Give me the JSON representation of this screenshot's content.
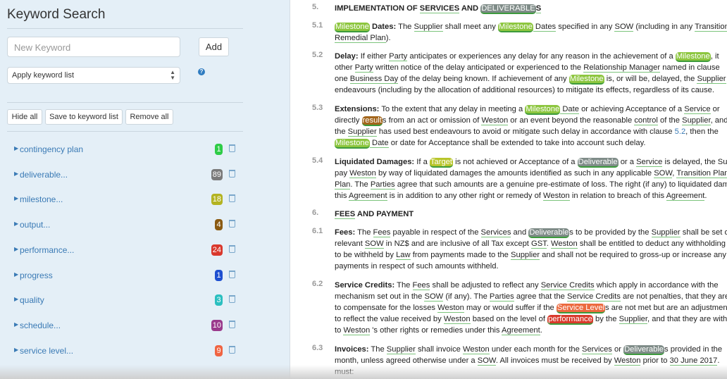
{
  "sidebar": {
    "title": "Keyword Search",
    "keyword_placeholder": "New Keyword",
    "add_label": "Add",
    "keyword_list_select": "Apply keyword list",
    "help_icon": "question-circle-icon",
    "hide_all": "Hide all",
    "save_to_list": "Save to keyword list",
    "remove_all": "Remove all",
    "keywords": [
      {
        "label": "contingency plan",
        "count": "1",
        "color": "#2ecc47"
      },
      {
        "label": "deliverable...",
        "count": "89",
        "color": "#7a7a7a"
      },
      {
        "label": "milestone...",
        "count": "18",
        "color": "#b3b322"
      },
      {
        "label": "output...",
        "count": "4",
        "color": "#8a5a12"
      },
      {
        "label": "performance...",
        "count": "24",
        "color": "#d9382c"
      },
      {
        "label": "progress",
        "count": "1",
        "color": "#1e4fd0"
      },
      {
        "label": "quality",
        "count": "3",
        "color": "#2bbfc0"
      },
      {
        "label": "schedule...",
        "count": "10",
        "color": "#9a3a8c"
      },
      {
        "label": "service level...",
        "count": "9",
        "color": "#f06442"
      }
    ]
  },
  "document": {
    "blocks": [
      {
        "num": "5.",
        "lines": [
          [
            [
              "IMPLEMENTATION OF ",
              "b"
            ],
            [
              "SERVICES",
              "bu"
            ],
            [
              " AND ",
              "b"
            ],
            [
              "DELIVERABLE",
              "hl-deliverable"
            ],
            [
              "S",
              "bu"
            ]
          ]
        ]
      },
      {
        "num": "5.1",
        "lines": [
          [
            [
              "Milestone",
              "hl-milestone"
            ],
            [
              " Dates:",
              "b"
            ],
            [
              " The ",
              ""
            ],
            [
              "Supplier",
              "u"
            ],
            [
              " shall meet any ",
              ""
            ],
            [
              "Milestone",
              "hl-milestone"
            ],
            [
              " Dates",
              "u"
            ],
            [
              " specified in any ",
              ""
            ],
            [
              "SOW",
              "u"
            ],
            [
              " (including in any ",
              ""
            ],
            [
              "Transition",
              "u"
            ]
          ],
          [
            [
              "Remedial Plan",
              "u"
            ],
            [
              ").",
              ""
            ]
          ]
        ]
      },
      {
        "num": "5.2",
        "lines": [
          [
            [
              "Delay:",
              "b"
            ],
            [
              " If either ",
              ""
            ],
            [
              "Party",
              "u"
            ],
            [
              " anticipates or experiences any delay for any reason in the achievement of a ",
              ""
            ],
            [
              "Milestone",
              "hl-milestone"
            ],
            [
              ", it",
              ""
            ]
          ],
          [
            [
              "other ",
              ""
            ],
            [
              "Party",
              "u"
            ],
            [
              " written notice of the delay anticipated or experienced to the ",
              ""
            ],
            [
              "Relationship Manager",
              "u"
            ],
            [
              " named in clause",
              ""
            ]
          ],
          [
            [
              "one ",
              ""
            ],
            [
              "Business Day",
              "u"
            ],
            [
              " of the delay being known. If achievement of any ",
              ""
            ],
            [
              "Milestone",
              "hl-milestone"
            ],
            [
              " is, or will be, delayed, the ",
              ""
            ],
            [
              "Supplier",
              "u"
            ]
          ],
          [
            [
              "endeavours (including by the allocation of additional resources) to mitigate its effects, regardless of its cause.",
              ""
            ]
          ]
        ]
      },
      {
        "num": "5.3",
        "lines": [
          [
            [
              "Extensions:",
              "b"
            ],
            [
              " To the extent that any delay in meeting a ",
              ""
            ],
            [
              "Milestone",
              "hl-milestone"
            ],
            [
              " Date",
              "u"
            ],
            [
              " or achieving Acceptance of a ",
              ""
            ],
            [
              "Service",
              "u"
            ],
            [
              " or",
              ""
            ]
          ],
          [
            [
              "directly ",
              ""
            ],
            [
              "result",
              "hl-result"
            ],
            [
              "s from an act or omission of ",
              ""
            ],
            [
              "Weston",
              "u"
            ],
            [
              " or an event beyond the reasonable ",
              ""
            ],
            [
              "control",
              "u"
            ],
            [
              " of the ",
              ""
            ],
            [
              "Supplier",
              "u"
            ],
            [
              ", and",
              ""
            ]
          ],
          [
            [
              "the ",
              ""
            ],
            [
              "Supplier",
              "u"
            ],
            [
              " has used best endeavours to avoid or mitigate such delay in accordance with clause ",
              ""
            ],
            [
              "5.2",
              "link"
            ],
            [
              ", then the",
              ""
            ]
          ],
          [
            [
              "Milestone",
              "hl-milestone"
            ],
            [
              " Date",
              "u"
            ],
            [
              " or date for Acceptance shall be extended to take into account such delay.",
              ""
            ]
          ]
        ]
      },
      {
        "num": "5.4",
        "lines": [
          [
            [
              "Liquidated Damages:",
              "b"
            ],
            [
              " If a ",
              ""
            ],
            [
              "Target",
              "hl-target"
            ],
            [
              " is not achieved or Acceptance of a ",
              ""
            ],
            [
              "Deliverable",
              "hl-deliverable"
            ],
            [
              " or a ",
              ""
            ],
            [
              "Service",
              "u"
            ],
            [
              " is delayed, the Supplier",
              ""
            ]
          ],
          [
            [
              "pay ",
              ""
            ],
            [
              "Weston",
              "u"
            ],
            [
              " by way of liquidated damages the amounts identified as such in any applicable ",
              ""
            ],
            [
              "SOW",
              "u"
            ],
            [
              ", ",
              ""
            ],
            [
              "Transition Plan",
              "u"
            ]
          ],
          [
            [
              "Plan",
              "u"
            ],
            [
              ". The ",
              ""
            ],
            [
              "Parties",
              "u"
            ],
            [
              " agree that such amounts are a genuine pre-estimate of loss. The right (if any) to liquidated damages",
              ""
            ]
          ],
          [
            [
              "this ",
              ""
            ],
            [
              "Agreement",
              "u"
            ],
            [
              " is in addition to any other right or remedy of ",
              ""
            ],
            [
              "Weston",
              "u"
            ],
            [
              " in relation to breach of this ",
              ""
            ],
            [
              "Agreement",
              "u"
            ],
            [
              ".",
              ""
            ]
          ]
        ]
      },
      {
        "num": "6.",
        "lines": [
          [
            [
              "FEES",
              "bu"
            ],
            [
              " AND PAYMENT",
              "b"
            ]
          ]
        ]
      },
      {
        "num": "6.1",
        "lines": [
          [
            [
              "Fees:",
              "b"
            ],
            [
              " The ",
              ""
            ],
            [
              "Fees",
              "u"
            ],
            [
              " payable in respect of the ",
              ""
            ],
            [
              "Services",
              "u"
            ],
            [
              " and ",
              ""
            ],
            [
              "Deliverable",
              "hl-deliverable"
            ],
            [
              "s to be provided by the ",
              ""
            ],
            [
              "Supplier",
              "u"
            ],
            [
              " shall be set out in the",
              ""
            ]
          ],
          [
            [
              "relevant ",
              ""
            ],
            [
              "SOW",
              "u"
            ],
            [
              " in NZ$ and are inclusive of all Tax except ",
              ""
            ],
            [
              "GST",
              "u"
            ],
            [
              ". ",
              ""
            ],
            [
              "Weston",
              "u"
            ],
            [
              " shall be entitled to deduct any withholding",
              ""
            ]
          ],
          [
            [
              "to be withheld by ",
              ""
            ],
            [
              "Law",
              "u"
            ],
            [
              " from payments made to the ",
              ""
            ],
            [
              "Supplier",
              "u"
            ],
            [
              " and shall not be required to gross-up or increase any",
              ""
            ]
          ],
          [
            [
              "payments in respect of such amounts withheld.",
              ""
            ]
          ]
        ]
      },
      {
        "num": "6.2",
        "lines": [
          [
            [
              "Service Credits:",
              "b"
            ],
            [
              " The ",
              ""
            ],
            [
              "Fees",
              "u"
            ],
            [
              " shall be adjusted to reflect any ",
              ""
            ],
            [
              "Service Credits",
              "u"
            ],
            [
              " which apply in accordance with the",
              ""
            ]
          ],
          [
            [
              "mechanism set out in the ",
              ""
            ],
            [
              "SOW",
              "u"
            ],
            [
              " (if any). The ",
              ""
            ],
            [
              "Parties",
              "u"
            ],
            [
              " agree that the ",
              ""
            ],
            [
              "Service Credits",
              "u"
            ],
            [
              " are not penalties, that they are",
              ""
            ]
          ],
          [
            [
              "to compensate for the losses ",
              ""
            ],
            [
              "Weston",
              "u"
            ],
            [
              " may or would suffer if the ",
              ""
            ],
            [
              "Service Level",
              "hl-servicelevel"
            ],
            [
              "s are not met but are an adjustment",
              ""
            ]
          ],
          [
            [
              "to reflect the value received by ",
              ""
            ],
            [
              "Weston",
              "u"
            ],
            [
              " based on the level of ",
              ""
            ],
            [
              "performance",
              "hl-performance"
            ],
            [
              " by the ",
              ""
            ],
            [
              "Supplier",
              "u"
            ],
            [
              ", and that they are without prejudice",
              ""
            ]
          ],
          [
            [
              "to ",
              ""
            ],
            [
              "Weston",
              "u"
            ],
            [
              " 's other rights or remedies under this ",
              ""
            ],
            [
              "Agreement",
              "u"
            ],
            [
              ".",
              ""
            ]
          ]
        ]
      },
      {
        "num": "6.3",
        "lines": [
          [
            [
              "Invoices:",
              "b"
            ],
            [
              " The ",
              ""
            ],
            [
              "Supplier",
              "u"
            ],
            [
              " shall invoice ",
              ""
            ],
            [
              "Weston",
              "u"
            ],
            [
              " under each month for the ",
              ""
            ],
            [
              "Services",
              "u"
            ],
            [
              " or ",
              ""
            ],
            [
              "Deliverable",
              "hl-deliverable"
            ],
            [
              "s provided in the",
              ""
            ]
          ],
          [
            [
              "month, unless agreed otherwise under a ",
              ""
            ],
            [
              "SOW",
              "u"
            ],
            [
              ". All invoices must be received by ",
              ""
            ],
            [
              "Weston",
              "u"
            ],
            [
              " prior to ",
              ""
            ],
            [
              "30 June 2017",
              "u"
            ],
            [
              ".",
              ""
            ]
          ],
          [
            [
              "must:",
              ""
            ]
          ]
        ]
      }
    ]
  }
}
